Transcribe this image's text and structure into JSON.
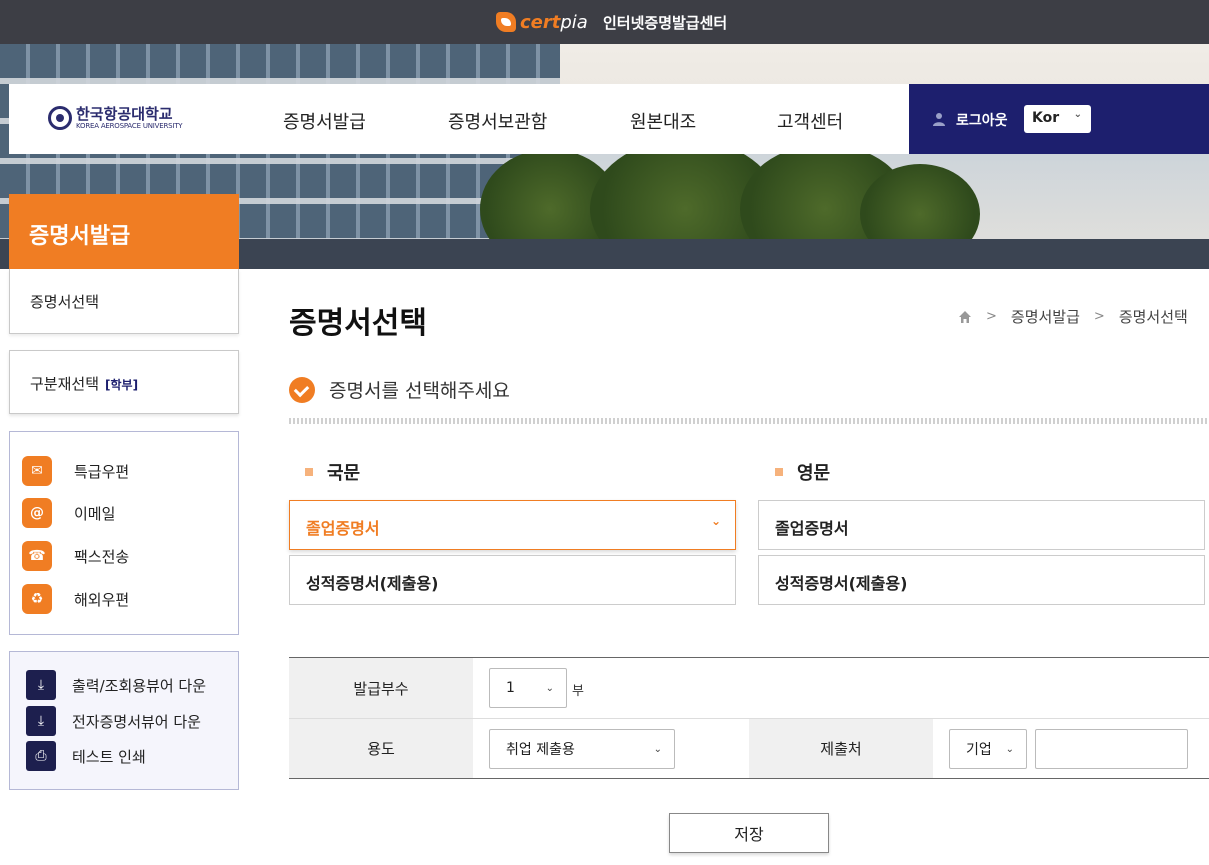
{
  "topbar": {
    "brand_cert": "cert",
    "brand_pia": "pia",
    "title": "인터넷증명발급센터"
  },
  "header": {
    "univ_name": "한국항공대학교",
    "univ_eng": "KOREA AEROSPACE UNIVERSITY",
    "nav": [
      "증명서발급",
      "증명서보관함",
      "원본대조",
      "고객센터"
    ],
    "logout": "로그아웃",
    "lang": "Kor"
  },
  "sidebar": {
    "heading": "증명서발급",
    "sub_item": "증명서선택",
    "major_label": "구분재선택",
    "major_tag": "[학부]",
    "delivery": [
      "특급우편",
      "이메일",
      "팩스전송",
      "해외우편"
    ],
    "downloads": [
      "출력/조회용뷰어 다운",
      "전자증명서뷰어 다운",
      "테스트 인쇄"
    ]
  },
  "main": {
    "title": "증명서선택",
    "breadcrumb": [
      "증명서발급",
      "증명서선택"
    ],
    "instruction": "증명서를 선택해주세요",
    "korean": {
      "label": "국문",
      "options": [
        "졸업증명서",
        "성적증명서(제출용)"
      ]
    },
    "english": {
      "label": "영문",
      "options": [
        "졸업증명서",
        "성적증명서(제출용)"
      ]
    }
  },
  "form": {
    "copies_label": "발급부수",
    "copies_value": "1",
    "copies_unit": "부",
    "purpose_label": "용도",
    "purpose_value": "취업 제출용",
    "dest_label": "제출처",
    "dest_type": "기업",
    "dest_value": "",
    "save": "저장"
  },
  "colors": {
    "accent": "#f07d23",
    "navy": "#1d1f6e",
    "topbar": "#3d3e45"
  }
}
